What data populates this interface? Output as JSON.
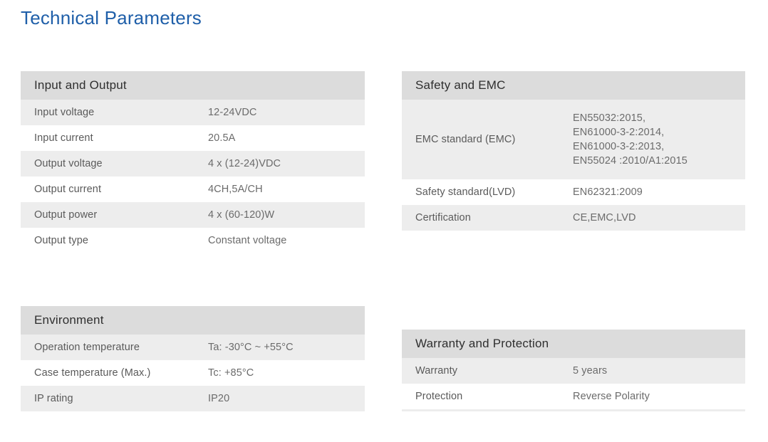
{
  "page": {
    "title": "Technical Parameters",
    "title_color": "#1f5fa9",
    "header_bg": "#dcdcdc",
    "row_shaded_bg": "#ededed",
    "divider_color": "#9a9a9a"
  },
  "tables": [
    {
      "id": "input-and-output",
      "header": "Input and Output",
      "rows": [
        {
          "label": "Input voltage",
          "value": "12-24VDC"
        },
        {
          "label": "Input current",
          "value": "20.5A"
        },
        {
          "label": "Output voltage",
          "value": "4 x (12-24)VDC"
        },
        {
          "label": "Output current",
          "value": "4CH,5A/CH"
        },
        {
          "label": "Output power",
          "value": "4 x (60-120)W"
        },
        {
          "label": "Output type",
          "value": "Constant voltage"
        }
      ]
    },
    {
      "id": "safety-and-emc",
      "header": "Safety and EMC",
      "rows": [
        {
          "label": "EMC standard (EMC)",
          "value": "EN55032:2015,\nEN61000-3-2:2014,\nEN61000-3-2:2013,\nEN55024 :2010/A1:2015"
        },
        {
          "label": "Safety standard(LVD)",
          "value": "EN62321:2009"
        },
        {
          "label": "Certification",
          "value": "CE,EMC,LVD"
        }
      ]
    },
    {
      "id": "environment",
      "header": "Environment",
      "rows": [
        {
          "label": "Operation temperature",
          "value": "Ta: -30°C ~ +55°C"
        },
        {
          "label": "Case temperature (Max.)",
          "value": "Tc: +85°C"
        },
        {
          "label": "IP rating",
          "value": "IP20"
        }
      ]
    },
    {
      "id": "warranty-and-protection",
      "header": "Warranty and Protection",
      "rows": [
        {
          "label": "Warranty",
          "value": "5 years"
        },
        {
          "label": "Protection",
          "value": "Reverse Polarity"
        }
      ]
    }
  ]
}
